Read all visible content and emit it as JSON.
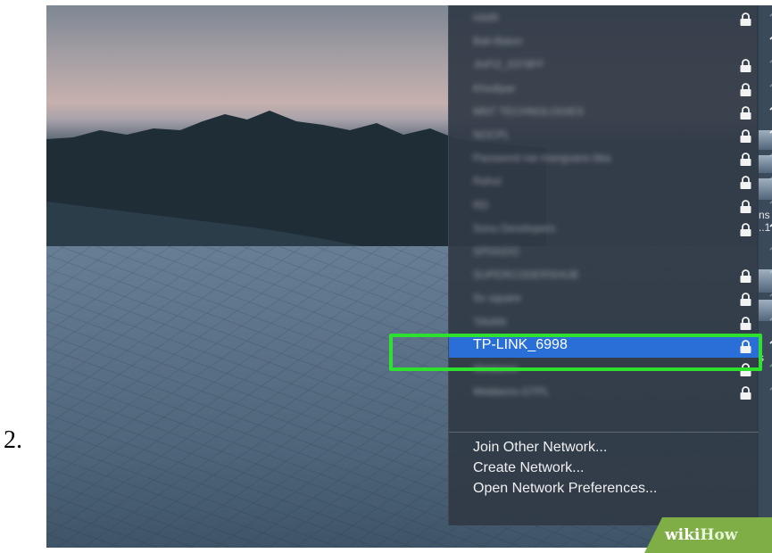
{
  "step_number": "2.",
  "wifi_menu": {
    "networks": [
      {
        "name": "HAIR",
        "locked": true,
        "signal": 2
      },
      {
        "name": "Bali-Baton",
        "locked": false,
        "signal": 3
      },
      {
        "name": "JioFi2_0378FF",
        "locked": true,
        "signal": 2
      },
      {
        "name": "Khodiyar",
        "locked": true,
        "signal": 2
      },
      {
        "name": "MNT TECHNOLOGIES",
        "locked": true,
        "signal": 3
      },
      {
        "name": "NOCPL",
        "locked": true,
        "signal": 3
      },
      {
        "name": "Password nai mangvano bka",
        "locked": true,
        "signal": 2
      },
      {
        "name": "Rahul",
        "locked": true,
        "signal": 2
      },
      {
        "name": "RD",
        "locked": true,
        "signal": 2
      },
      {
        "name": "Sonu Developers",
        "locked": true,
        "signal": 3
      },
      {
        "name": "SPDGDO",
        "locked": false,
        "signal": 2
      },
      {
        "name": "SUPERCODERSHUB",
        "locked": true,
        "signal": 2
      },
      {
        "name": "Sv square",
        "locked": true,
        "signal": 2
      },
      {
        "name": "TAVAN",
        "locked": true,
        "signal": 2
      },
      {
        "name": "TP-LINK_6998",
        "locked": true,
        "signal": 3,
        "selected": true
      },
      {
        "name": "Webberis",
        "locked": true,
        "signal": 2
      },
      {
        "name": "Webberis-GTPL",
        "locked": true,
        "signal": 2
      }
    ],
    "actions": {
      "join_other": "Join Other Network...",
      "create": "Create Network...",
      "preferences": "Open Network Preferences..."
    }
  },
  "background_snippets": {
    "right_text_1": "ns",
    "right_text_2": "..1",
    "right_text_3": "s"
  },
  "watermark": {
    "part1": "wiki",
    "part2": "How"
  },
  "colors": {
    "selection": "#2a6fd8",
    "highlight_border": "#2fe12f",
    "watermark_bg": "#7fae46"
  }
}
